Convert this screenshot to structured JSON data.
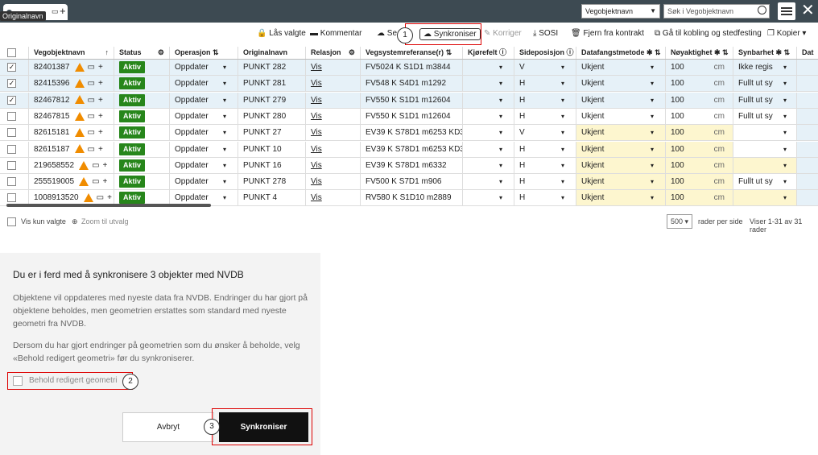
{
  "tab": {
    "tooltip": "Originalnavn"
  },
  "top": {
    "type_select": "Vegobjektnavn",
    "search_placeholder": "Søk i Vegobjektnavn"
  },
  "toolbar": {
    "lock": "Lås valgte",
    "comment": "Kommentar",
    "save": "Se",
    "sync": "Synkroniser",
    "correct": "Korriger",
    "sosi": "SOSI",
    "remove": "Fjern fra kontrakt",
    "goto": "Gå til kobling og stedfesting",
    "copy": "Kopier"
  },
  "columns": [
    "Vegobjektnavn",
    "Status",
    "Operasjon",
    "Originalnavn",
    "Relasjon",
    "Vegsystemreferanse(r)",
    "Kjørefelt",
    "Sideposisjon",
    "Datafangstmetode",
    "Nøyaktighet",
    "Synbarhet",
    "Dat"
  ],
  "rows": [
    {
      "checked": true,
      "id": "82401387",
      "status": "Aktiv",
      "op": "Oppdater",
      "orig": "PUNKT 282",
      "rel": "Vis",
      "vref": "FV5024 K S1D1 m3844",
      "kf": "",
      "side": "V",
      "dfm": "Ukjent",
      "acc": "100",
      "unit": "cm",
      "syn": "Ikke regis"
    },
    {
      "checked": true,
      "id": "82415396",
      "status": "Aktiv",
      "op": "Oppdater",
      "orig": "PUNKT 281",
      "rel": "Vis",
      "vref": "FV548 K S4D1 m1292",
      "kf": "",
      "side": "H",
      "dfm": "Ukjent",
      "acc": "100",
      "unit": "cm",
      "syn": "Fullt ut sy"
    },
    {
      "checked": true,
      "id": "82467812",
      "status": "Aktiv",
      "op": "Oppdater",
      "orig": "PUNKT 279",
      "rel": "Vis",
      "vref": "FV550 K S1D1 m12604",
      "kf": "",
      "side": "H",
      "dfm": "Ukjent",
      "acc": "100",
      "unit": "cm",
      "syn": "Fullt ut sy"
    },
    {
      "checked": false,
      "id": "82467815",
      "status": "Aktiv",
      "op": "Oppdater",
      "orig": "PUNKT 280",
      "rel": "Vis",
      "vref": "FV550 K S1D1 m12604",
      "kf": "",
      "side": "H",
      "dfm": "Ukjent",
      "acc": "100",
      "unit": "cm",
      "syn": "Fullt ut sy"
    },
    {
      "checked": false,
      "id": "82615181",
      "status": "Aktiv",
      "op": "Oppdater",
      "orig": "PUNKT 27",
      "rel": "Vis",
      "vref": "EV39 K S78D1 m6253 KD3 m11",
      "kf": "",
      "side": "V",
      "dfm": "Ukjent",
      "acc": "100",
      "unit": "cm",
      "syn": ""
    },
    {
      "checked": false,
      "id": "82615187",
      "status": "Aktiv",
      "op": "Oppdater",
      "orig": "PUNKT 10",
      "rel": "Vis",
      "vref": "EV39 K S78D1 m6253 KD3 m11",
      "kf": "",
      "side": "H",
      "dfm": "Ukjent",
      "acc": "100",
      "unit": "cm",
      "syn": ""
    },
    {
      "checked": false,
      "id": "219658552",
      "status": "Aktiv",
      "op": "Oppdater",
      "orig": "PUNKT 16",
      "rel": "Vis",
      "vref": "EV39 K S78D1 m6332",
      "kf": "",
      "side": "H",
      "dfm": "Ukjent",
      "acc": "100",
      "unit": "cm",
      "syn": ""
    },
    {
      "checked": false,
      "id": "255519005",
      "status": "Aktiv",
      "op": "Oppdater",
      "orig": "PUNKT 278",
      "rel": "Vis",
      "vref": "FV500 K S7D1 m906",
      "kf": "",
      "side": "H",
      "dfm": "Ukjent",
      "acc": "100",
      "unit": "cm",
      "syn": "Fullt ut sy"
    },
    {
      "checked": false,
      "id": "1008913520",
      "status": "Aktiv",
      "op": "Oppdater",
      "orig": "PUNKT 4",
      "rel": "Vis",
      "vref": "RV580 K S1D10 m2889",
      "kf": "",
      "side": "H",
      "dfm": "Ukjent",
      "acc": "100",
      "unit": "cm",
      "syn": ""
    }
  ],
  "footer": {
    "only_selected": "Vis kun valgte",
    "zoom": "Zoom til utvalg",
    "page_size": "500",
    "rows_per_page": "rader per side",
    "count": "Viser 1-31 av 31 rader"
  },
  "modal": {
    "title": "Du er i ferd med å synkronisere 3 objekter med NVDB",
    "p1": "Objektene vil oppdateres med nyeste data fra NVDB. Endringer du har gjort på objektene beholdes, men geometrien erstattes som standard med nyeste geometri fra NVDB.",
    "p2": "Dersom du har gjort endringer på geometrien som du ønsker å beholde, velg «Behold redigert geometri» før du synkroniserer.",
    "keep_geom": "Behold redigert geometri",
    "cancel": "Avbryt",
    "confirm": "Synkroniser"
  },
  "callouts": [
    "1",
    "2",
    "3"
  ]
}
